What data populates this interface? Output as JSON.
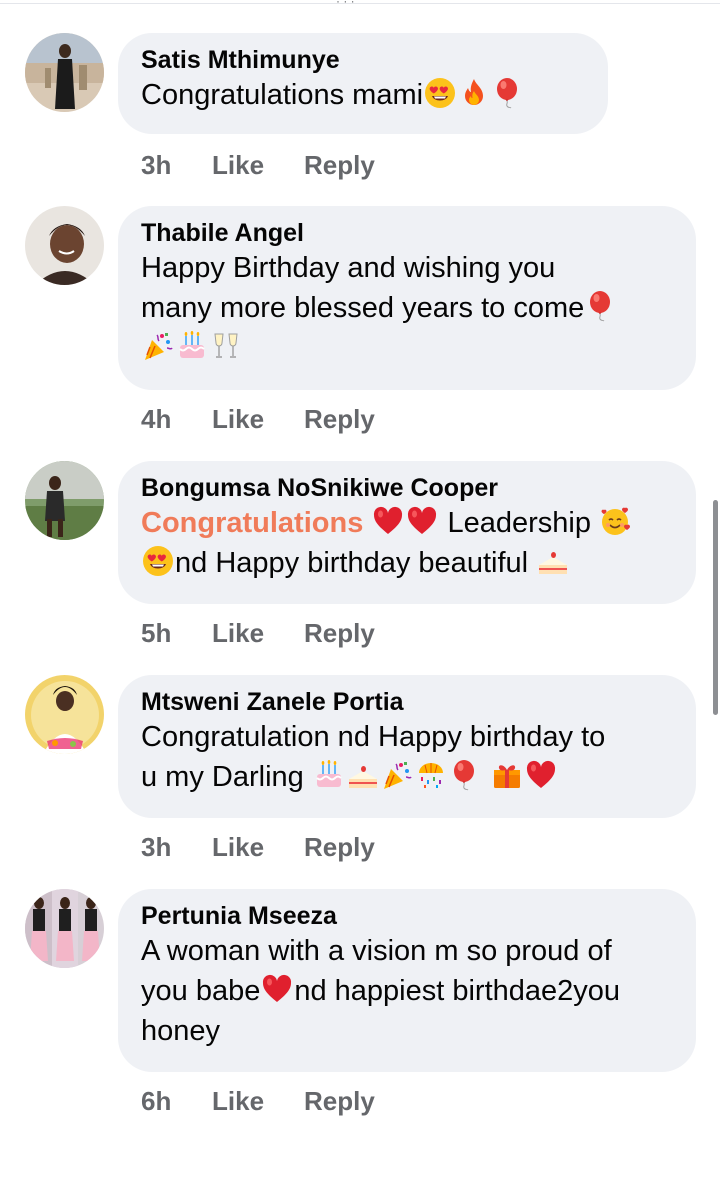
{
  "comments": [
    {
      "author": "Satis Mthimunye",
      "text": "Congratulations mami",
      "time": "3h",
      "like_label": "Like",
      "reply_label": "Reply",
      "emojis": [
        "heart-eyes",
        "fire",
        "balloon"
      ]
    },
    {
      "author": "Thabile Angel",
      "text_line1": "Happy Birthday and wishing you",
      "text_line2": "many more blessed years to come",
      "time": "4h",
      "like_label": "Like",
      "reply_label": "Reply",
      "emojis": [
        "balloon",
        "party-popper",
        "birthday-cake",
        "champagne-glasses"
      ]
    },
    {
      "author": "Bongumsa NoSnikiwe Cooper",
      "highlight": "Congratulations",
      "text_a": "Leadership",
      "text_b": "nd Happy birthday beautiful",
      "time": "5h",
      "like_label": "Like",
      "reply_label": "Reply",
      "emojis": [
        "red-heart",
        "red-heart",
        "smiling-face-with-hearts",
        "heart-eyes",
        "shortcake"
      ]
    },
    {
      "author": "Mtsweni Zanele Portia",
      "text_line1": "Congratulation nd Happy birthday to",
      "text_line2": "u my Darling",
      "time": "3h",
      "like_label": "Like",
      "reply_label": "Reply",
      "emojis": [
        "birthday-cake",
        "shortcake",
        "party-popper",
        "confetti-ball",
        "balloon",
        "wrapped-gift",
        "red-heart"
      ]
    },
    {
      "author": "Pertunia Mseeza",
      "text_line1": "A woman with a vision m so proud of",
      "text_line2a": "you babe",
      "text_line2b": "nd happiest birthdae2you",
      "text_line3": "honey",
      "time": "6h",
      "like_label": "Like",
      "reply_label": "Reply",
      "emojis": [
        "red-heart"
      ]
    }
  ]
}
